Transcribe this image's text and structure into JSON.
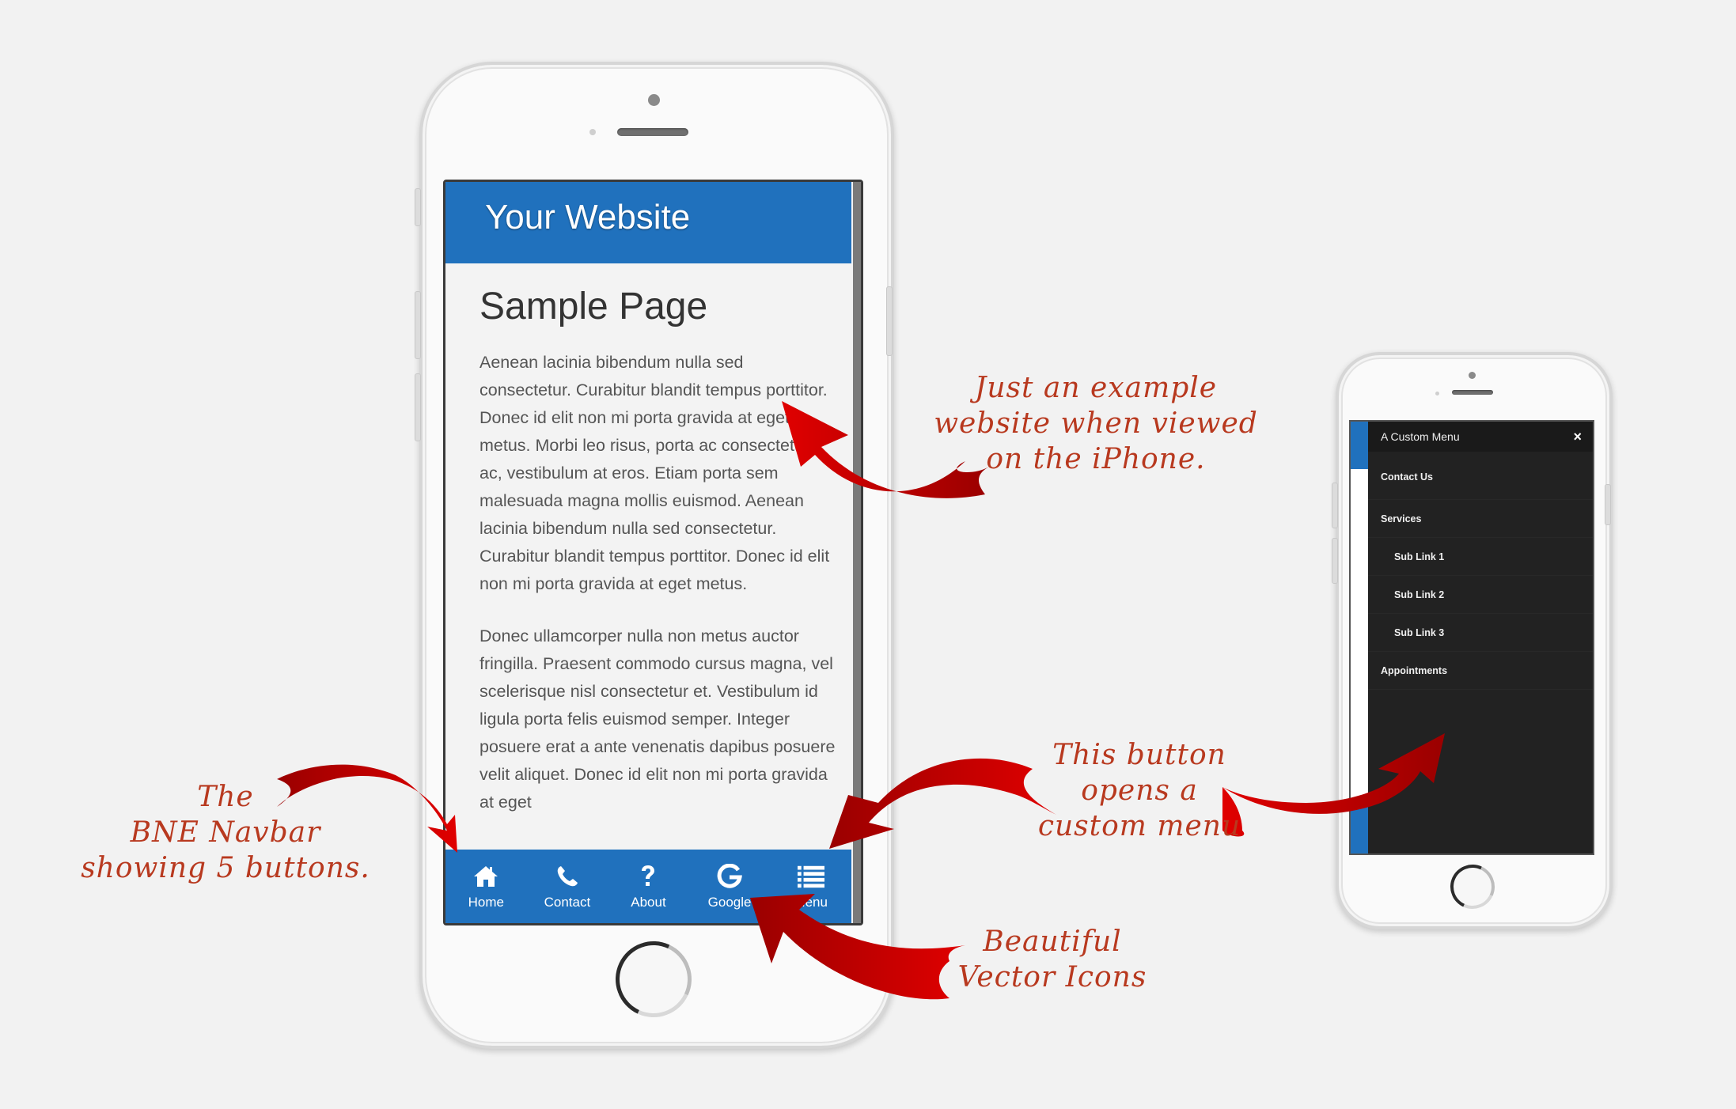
{
  "colors": {
    "brand_blue": "#2071bd",
    "menu_dark": "#222222",
    "annotation_red": "#b8391f",
    "arrow_red": "#d40000"
  },
  "main_phone": {
    "site_title": "Your Website",
    "page_title": "Sample Page",
    "paragraphs": [
      "Aenean lacinia bibendum nulla sed consectetur. Curabitur blandit tempus porttitor. Donec id elit non mi porta gravida at eget metus. Morbi leo risus, porta ac consectetur ac, vestibulum at eros. Etiam porta sem malesuada magna mollis euismod. Aenean lacinia bibendum nulla sed consectetur. Curabitur blandit tempus porttitor. Donec id elit non mi porta gravida at eget metus.",
      "Donec ullamcorper nulla non metus auctor fringilla. Praesent commodo cursus magna, vel scelerisque nisl consectetur et. Vestibulum id ligula porta felis euismod semper. Integer posuere erat a ante venenatis dapibus posuere velit aliquet. Donec id elit non mi porta gravida at eget"
    ],
    "navbar": [
      {
        "label": "Home",
        "icon": "home-icon"
      },
      {
        "label": "Contact",
        "icon": "phone-icon"
      },
      {
        "label": "About",
        "icon": "question-icon"
      },
      {
        "label": "Google",
        "icon": "google-icon"
      },
      {
        "label": "Menu",
        "icon": "list-icon"
      }
    ]
  },
  "menu_phone": {
    "menu_title": "A Custom Menu",
    "close_icon": "×",
    "items": [
      {
        "label": "Contact Us",
        "level": 0
      },
      {
        "label": "Services",
        "level": 0
      },
      {
        "label": "Sub Link 1",
        "level": 1
      },
      {
        "label": "Sub Link 2",
        "level": 1
      },
      {
        "label": "Sub Link 3",
        "level": 1
      },
      {
        "label": "Appointments",
        "level": 0
      }
    ]
  },
  "annotations": {
    "example_site": [
      "Just an example",
      "website when viewed",
      "on the iPhone."
    ],
    "navbar": [
      "The",
      "BNE Navbar",
      "showing 5 buttons."
    ],
    "custom_menu": [
      "This button",
      "opens a",
      "custom menu"
    ],
    "icons": [
      "Beautiful",
      "Vector Icons"
    ]
  }
}
